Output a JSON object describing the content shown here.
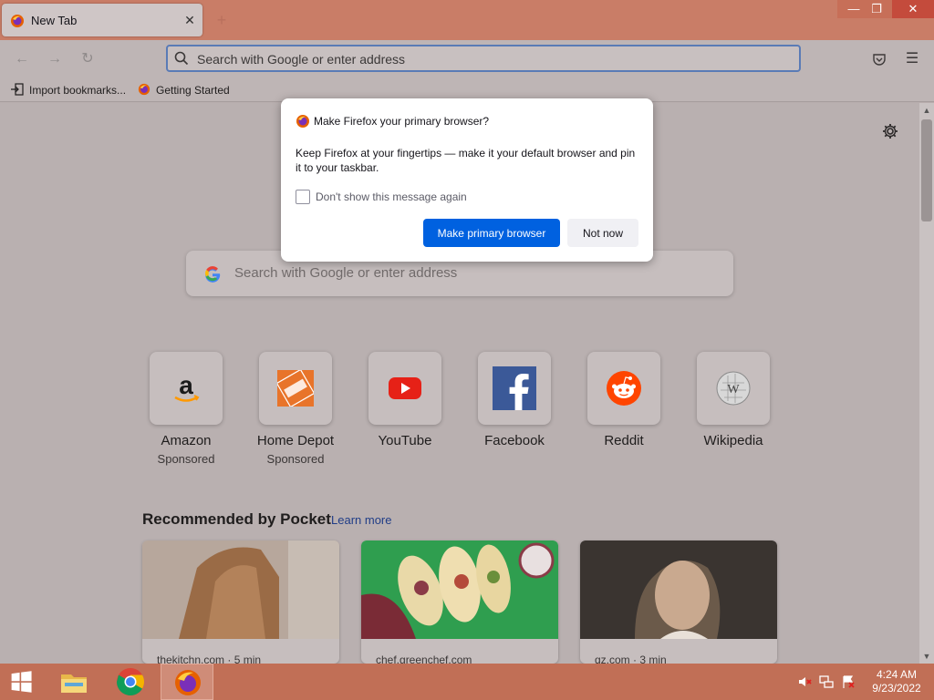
{
  "browser": {
    "tab": {
      "title": "New Tab",
      "close": "✕"
    },
    "new_tab": "+",
    "window_controls": {
      "minimize": "—",
      "maximize": "❐",
      "close": "✕"
    },
    "urlbar": {
      "placeholder": "Search with Google or enter address"
    },
    "bookmarks": [
      {
        "label": "Import bookmarks...",
        "icon": "import-icon"
      },
      {
        "label": "Getting Started",
        "icon": "firefox-icon"
      }
    ]
  },
  "newtab": {
    "search": {
      "placeholder": "Search with Google or enter address"
    },
    "top_sites": [
      {
        "name": "Amazon",
        "sponsor": "Sponsored",
        "icon": "amazon-icon"
      },
      {
        "name": "Home Depot",
        "sponsor": "Sponsored",
        "icon": "home-depot-icon"
      },
      {
        "name": "YouTube",
        "sponsor": "",
        "icon": "youtube-icon"
      },
      {
        "name": "Facebook",
        "sponsor": "",
        "icon": "facebook-icon"
      },
      {
        "name": "Reddit",
        "sponsor": "",
        "icon": "reddit-icon"
      },
      {
        "name": "Wikipedia",
        "sponsor": "",
        "icon": "wikipedia-icon"
      }
    ],
    "pocket": {
      "title": "Recommended by Pocket",
      "learn_more": "Learn more",
      "cards": [
        {
          "source": "thekitchn.com · 5 min"
        },
        {
          "source": "chef.greenchef.com"
        },
        {
          "source": "qz.com · 3 min"
        }
      ]
    }
  },
  "dialog": {
    "title": "Make Firefox your primary browser?",
    "body": "Keep Firefox at your fingertips — make it your default browser and pin it to your taskbar.",
    "checkbox_label": "Don't show this message again",
    "checkbox_checked": false,
    "primary_button": "Make primary browser",
    "secondary_button": "Not now"
  },
  "taskbar": {
    "items": [
      "windows-start-icon",
      "file-explorer-icon",
      "chrome-icon",
      "firefox-icon"
    ],
    "clock": {
      "time": "4:24 AM",
      "date": "9/23/2022"
    }
  },
  "colors": {
    "titlebar": "#c97d67",
    "accent_blue": "#0061e0",
    "taskbar": "#c16f56"
  }
}
